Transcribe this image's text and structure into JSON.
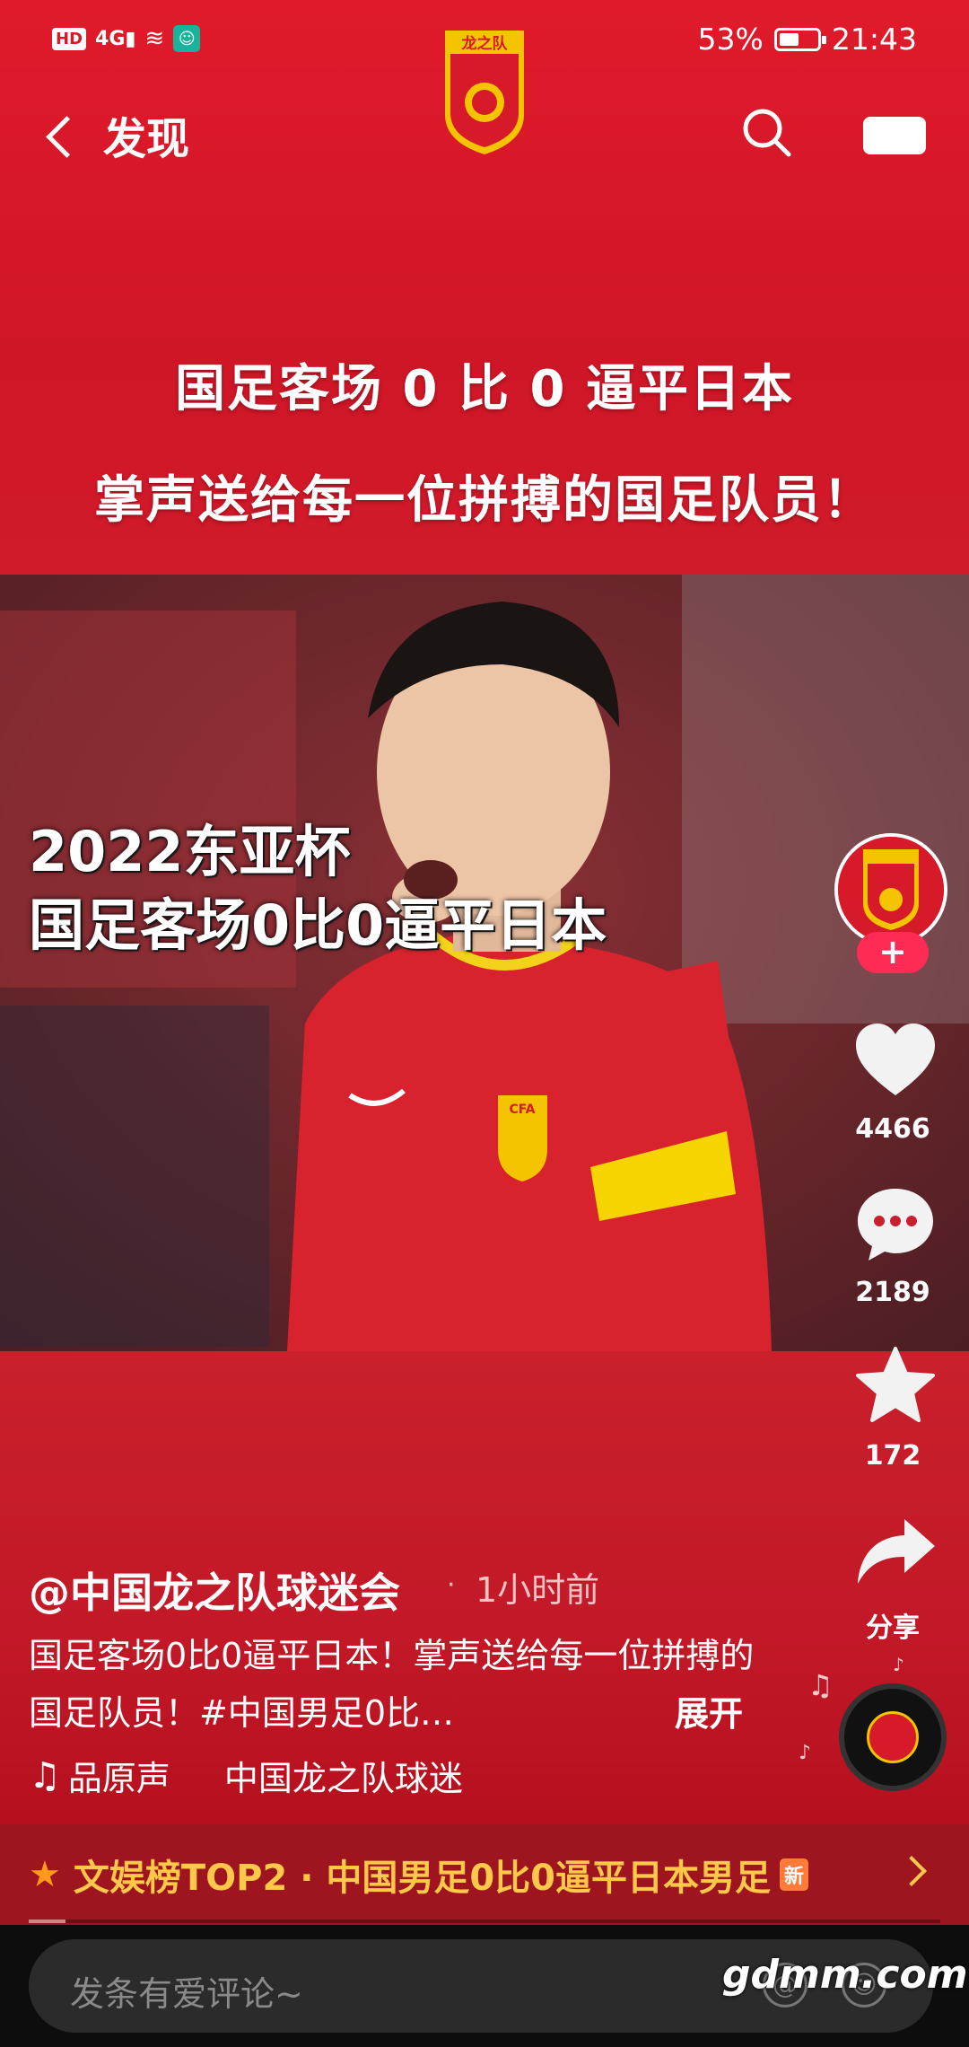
{
  "status_bar": {
    "hd": "HD",
    "net": "4G",
    "battery_text": "53%",
    "battery_level": 0.53,
    "time": "21:43"
  },
  "nav": {
    "back_label": "发现",
    "logo_text": "龙之队",
    "icons": [
      "back-chevron-icon",
      "search-icon",
      "video-icon"
    ]
  },
  "headline": {
    "line1": "国足客场 0 比 0 逼平日本",
    "line2": "掌声送给每一位拼搏的国足队员！"
  },
  "video": {
    "caption_line1": "2022东亚杯",
    "caption_line2": "国足客场0比0逼平日本",
    "jersey_text": "CFA"
  },
  "actions": {
    "likes": "4466",
    "comments": "2189",
    "favorites": "172",
    "share_label": "分享",
    "follow_label": "+"
  },
  "post": {
    "author": "@中国龙之队球迷会",
    "time": "1小时前",
    "description": "国足客场0比0逼平日本！掌声送给每一位拼搏的国足队员！#中国男足0比…",
    "expand_label": "展开",
    "music_label": "品原声",
    "music_owner": "中国龙之队球迷"
  },
  "trending": {
    "text": "文娱榜TOP2 · 中国男足0比0逼平日本男足",
    "badge": "新"
  },
  "comment_bar": {
    "placeholder": "发条有爱评论~",
    "watermark": "gdmm.com"
  },
  "colors": {
    "brand_red": "#d71a2a",
    "accent_pink": "#fe2c55",
    "trend_gold": "#ffc84a"
  }
}
